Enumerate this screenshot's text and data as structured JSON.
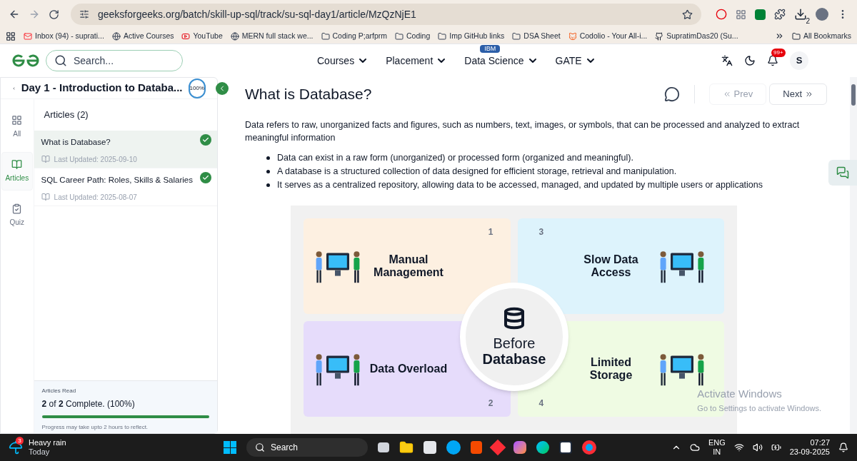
{
  "browser": {
    "url": "geeksforgeeks.org/batch/skill-up-sql/track/su-sql-day1/article/MzQzNjE1",
    "download_badge": "2",
    "bookmarks": [
      {
        "label": "Inbox (94) - suprati...",
        "kind": "mail"
      },
      {
        "label": "Active Courses",
        "kind": "site"
      },
      {
        "label": "YouTube",
        "kind": "video"
      },
      {
        "label": "MERN full stack we...",
        "kind": "site"
      },
      {
        "label": "Coding P;arfprm",
        "kind": "folder"
      },
      {
        "label": "Coding",
        "kind": "folder"
      },
      {
        "label": "Imp GitHub links",
        "kind": "folder"
      },
      {
        "label": "DSA Sheet",
        "kind": "folder"
      },
      {
        "label": "Codolio - Your All-i...",
        "kind": "cat"
      },
      {
        "label": "SupratimDas20 (Su...",
        "kind": "github"
      }
    ],
    "all_bookmarks": "All Bookmarks"
  },
  "site_header": {
    "search_placeholder": "Search...",
    "nav": [
      {
        "label": "Courses"
      },
      {
        "label": "Placement"
      },
      {
        "label": "Data Science",
        "badge": "IBM"
      },
      {
        "label": "GATE"
      }
    ],
    "notification_badge": "99+",
    "avatar": "S"
  },
  "sidebar": {
    "course_title": "Day 1 - Introduction to Databa...",
    "progress_ring": "100%",
    "tabs": [
      {
        "label": "All",
        "kind": "all",
        "selected": false
      },
      {
        "label": "Articles",
        "kind": "articles",
        "selected": true
      },
      {
        "label": "Quiz",
        "kind": "quiz",
        "selected": false
      }
    ],
    "articles_heading": "Articles (2)",
    "articles": [
      {
        "title": "What is Database?",
        "updated": "Last Updated: 2025-09-10",
        "selected": true,
        "completed": true
      },
      {
        "title": "SQL Career Path: Roles, Skills & Salaries",
        "updated": "Last Updated: 2025-08-07",
        "selected": false,
        "completed": true
      }
    ],
    "progress": {
      "heading": "Articles Read",
      "summary": "**2** of **2** Complete. (100%)",
      "level": 1,
      "note": "Progress may take upto 2 hours to reflect."
    }
  },
  "article": {
    "title": "What is Database?",
    "prev": {
      "label": "Prev",
      "disabled": true
    },
    "next": {
      "label": "Next",
      "disabled": false
    },
    "intro": "Data refers to raw, unorganized facts and figures, such as numbers, text, images, or symbols, that can be processed and analyzed to extract meaningful information",
    "bullets": [
      "Data can exist in a raw form (unorganized) or processed form (organized and meaningful).",
      "A database is a structured collection of data designed for efficient storage, retrieval and manipulation.",
      "It serves as a centralized repository, allowing data to be accessed, managed, and updated by multiple users or applications"
    ],
    "infographic": {
      "center_top": "Before",
      "center_bottom": "Database",
      "panels": [
        {
          "title": "Manual Management",
          "number": "1",
          "color": "#fdf0e1"
        },
        {
          "title": "Data Overload",
          "number": "2",
          "color": "#e6dcfb"
        },
        {
          "title": "Slow Data Access",
          "number": "3",
          "color": "#ddf3fc"
        },
        {
          "title": "Limited Storage",
          "number": "4",
          "color": "#effbe3"
        }
      ]
    }
  },
  "windows_overlay": {
    "title": "Activate Windows",
    "subtitle": "Go to Settings to activate Windows."
  },
  "taskbar": {
    "weather": {
      "badge": "3",
      "title": "Heavy rain",
      "subtitle": "Today"
    },
    "search_placeholder": "Search",
    "language": [
      "ENG",
      "IN"
    ],
    "time": "07:27",
    "date": "23-09-2025"
  }
}
